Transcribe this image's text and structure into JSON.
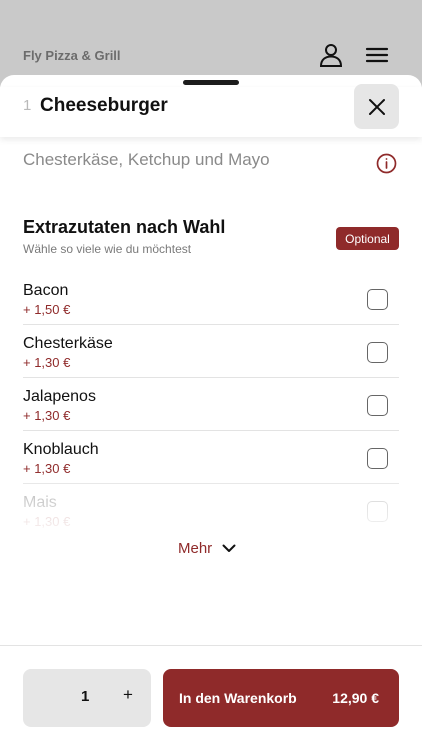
{
  "top_bar": {
    "app_name": "Fly Pizza & Grill",
    "icons": [
      "user-icon",
      "menu-icon"
    ]
  },
  "product": {
    "qty_prefix": "1",
    "title": "Cheeseburger",
    "description": "Chesterkäse, Ketchup und Mayo",
    "icons": [
      "close-icon",
      "info-icon"
    ]
  },
  "extras": {
    "title": "Extrazutaten nach Wahl",
    "subtitle": "Wähle so viele wie du möchtest",
    "badge": "Optional",
    "options": [
      {
        "name": "Bacon",
        "price": "+ 1,50 €",
        "checked": false
      },
      {
        "name": "Chesterkäse",
        "price": "+ 1,30 €",
        "checked": false
      },
      {
        "name": "Jalapenos",
        "price": "+ 1,30 €",
        "checked": false
      },
      {
        "name": "Knoblauch",
        "price": "+ 1,30 €",
        "checked": false
      },
      {
        "name": "Mais",
        "price": "+ 1,30 €",
        "checked": false
      }
    ],
    "more_label": "Mehr"
  },
  "footer": {
    "quantity": "1",
    "plus_label": "+",
    "cart_label": "In den Warenkorb",
    "total": "12,90 €"
  },
  "colors": {
    "accent": "#8f2a2a",
    "background_dim": "#c9c9c9",
    "button_grey": "#e6e6e6"
  }
}
